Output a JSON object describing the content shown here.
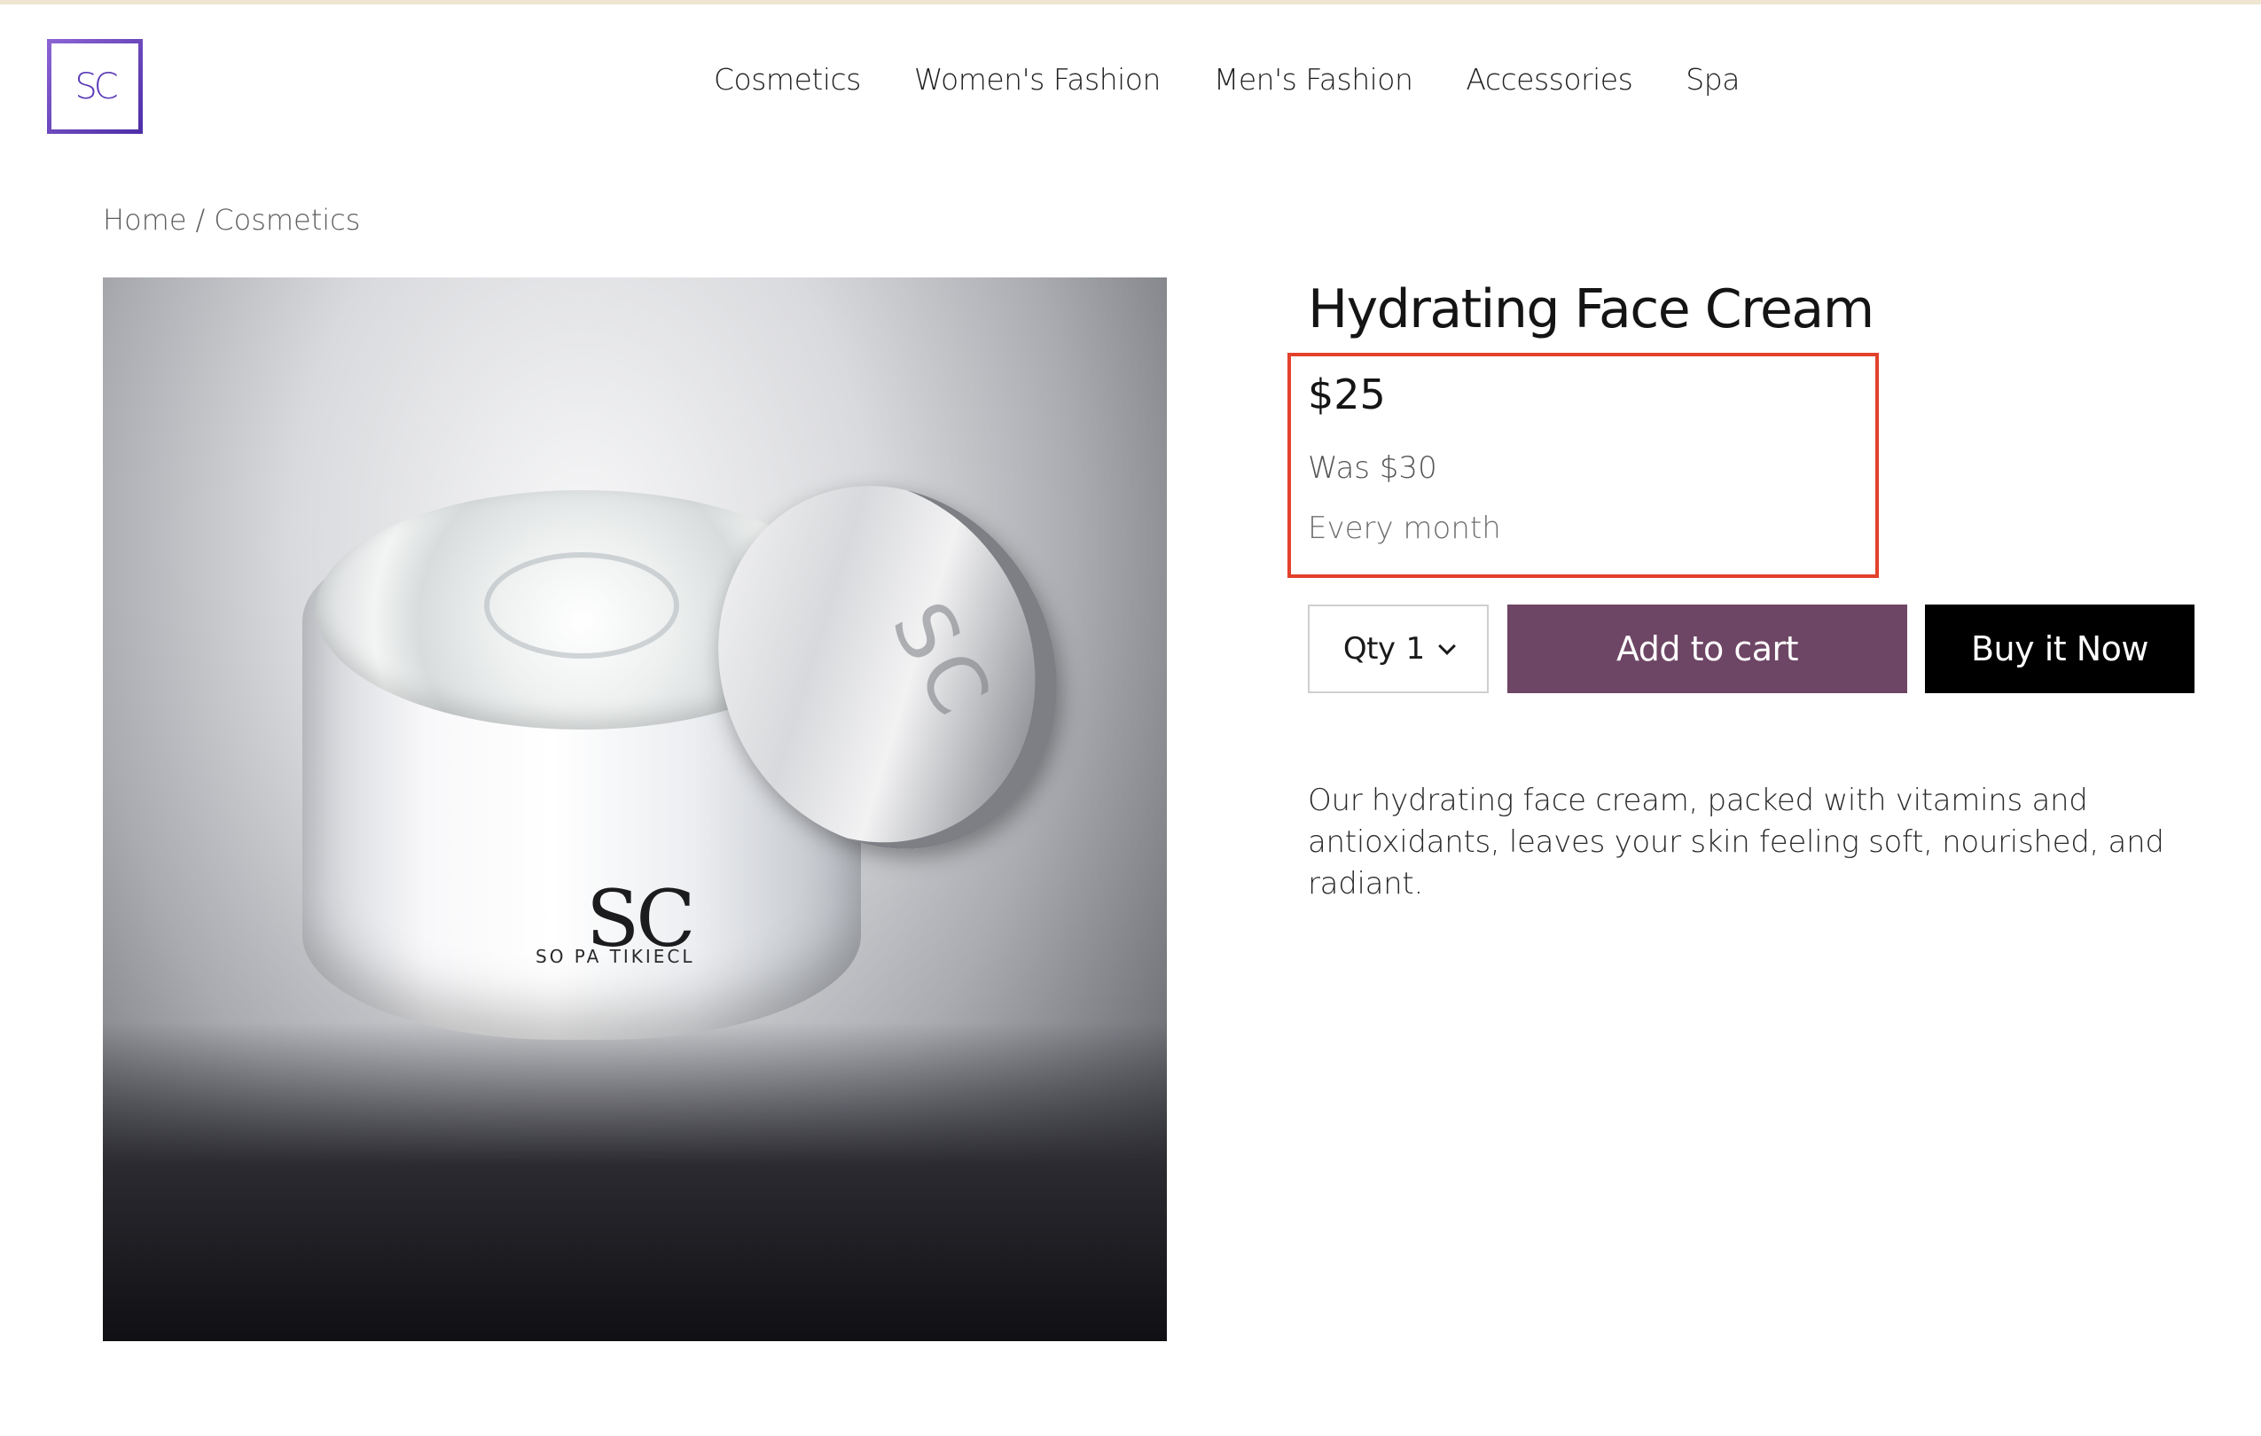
{
  "header": {
    "logo_text": "SC",
    "nav": [
      {
        "label": "Cosmetics"
      },
      {
        "label": "Women's Fashion"
      },
      {
        "label": "Men's Fashion"
      },
      {
        "label": "Accessories"
      },
      {
        "label": "Spa"
      }
    ]
  },
  "breadcrumb": {
    "home": "Home",
    "separator": "/",
    "current": "Cosmetics"
  },
  "product": {
    "title": "Hydrating Face Cream",
    "image": {
      "brand_mark": "SC",
      "brand_subtext": "SO PA TIKIECL"
    },
    "price": "$25",
    "was_price": "Was $30",
    "frequency": "Every month",
    "quantity": {
      "label": "Qty",
      "value": "1"
    },
    "add_to_cart_label": "Add to cart",
    "buy_now_label": "Buy it Now",
    "description": "Our hydrating face cream, packed with vitamins and antioxidants, leaves your skin feeling soft, nourished, and radiant."
  },
  "colors": {
    "brand_purple": "#6b46c1",
    "add_to_cart_bg": "#6e4665",
    "buy_now_bg": "#000000",
    "highlight_border": "#e3412b"
  },
  "icons": {
    "qty_dropdown": "chevron-down-icon"
  }
}
